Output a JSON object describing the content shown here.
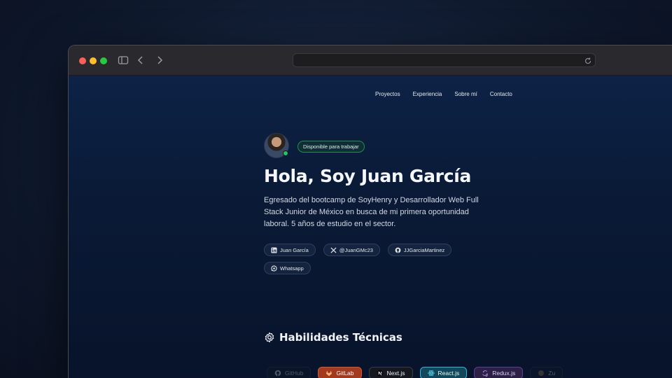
{
  "nav": {
    "items": [
      "Proyectos",
      "Experiencia",
      "Sobre mí",
      "Contacto"
    ]
  },
  "hero": {
    "badge": "Disponible para trabajar",
    "title": "Hola, Soy Juan García",
    "description": "Egresado del bootcamp de SoyHenry y Desarrollador Web Full Stack Junior de México en busca de mi primera oportunidad laboral. 5 años de estudio en el sector.",
    "socials": [
      {
        "icon": "linkedin-icon",
        "label": "Juan García"
      },
      {
        "icon": "x-icon",
        "label": "@JuanGMc23"
      },
      {
        "icon": "github-icon",
        "label": "JJGarciaMartinez"
      },
      {
        "icon": "whatsapp-icon",
        "label": "Whatsapp"
      }
    ]
  },
  "skills": {
    "heading": "Habilidades Técnicas",
    "items": [
      {
        "icon": "github-icon",
        "label": "GitHub"
      },
      {
        "icon": "gitlab-icon",
        "label": "GitLab"
      },
      {
        "icon": "nextjs-icon",
        "label": "Next.js"
      },
      {
        "icon": "react-icon",
        "label": "React.js"
      },
      {
        "icon": "redux-icon",
        "label": "Redux.js"
      },
      {
        "icon": "zustand-icon",
        "label": "Zu"
      }
    ]
  },
  "colors": {
    "available": "#22c55e",
    "gitlab": "#a33a1e",
    "react": "#2fb8d8",
    "redux": "#5b3f96"
  }
}
